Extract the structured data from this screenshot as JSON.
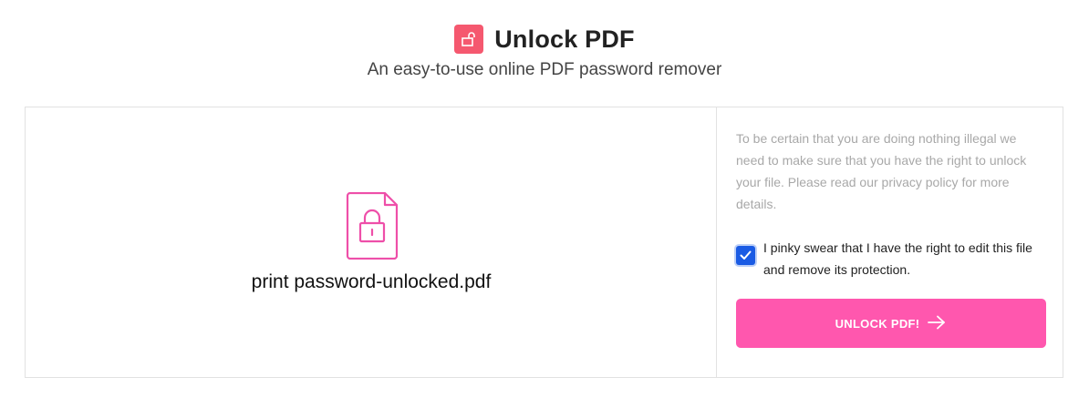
{
  "header": {
    "title": "Unlock PDF",
    "subtitle": "An easy-to-use online PDF password remover",
    "icon": "unlock-icon",
    "icon_color": "#f5586f"
  },
  "file": {
    "name": "print password-unlocked.pdf",
    "icon": "locked-file-icon",
    "icon_color": "#ee4fa9"
  },
  "sidebar": {
    "notice": "To be certain that you are doing nothing illegal we need to make sure that you have the right to unlock your file. Please read our privacy policy for more details.",
    "consent_label": "I pinky swear that I have the right to edit this file and remove its protection.",
    "consent_checked": true,
    "checkbox_color": "#1a5be4",
    "button_label": "UNLOCK PDF!",
    "button_icon": "arrow-right-icon",
    "button_color": "#ff57ae"
  }
}
